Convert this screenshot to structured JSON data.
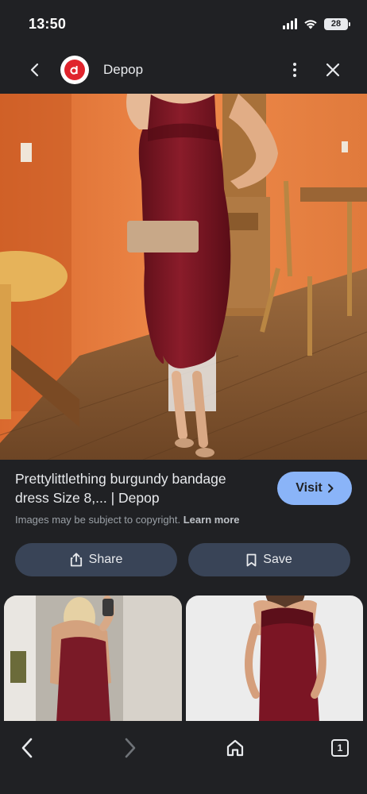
{
  "status": {
    "time": "13:50",
    "battery": "28"
  },
  "header": {
    "site_name": "Depop",
    "logo_letter": "d"
  },
  "result": {
    "title": "Prettylittlething burgundy bandage dress Size 8,... | Depop",
    "visit_label": "Visit",
    "copyright_text": "Images may be subject to copyright.",
    "learn_more": "Learn more"
  },
  "actions": {
    "share_label": "Share",
    "save_label": "Save"
  },
  "tabs": {
    "count": "1"
  },
  "colors": {
    "background": "#202124",
    "accent": "#8ab4f8",
    "button": "#394457",
    "brand_red": "#e0242d",
    "dress": "#7a1522"
  },
  "icons": [
    "back-icon",
    "more-vert-icon",
    "close-icon",
    "share-icon",
    "bookmark-icon",
    "home-icon",
    "forward-icon",
    "wifi-icon",
    "signal-icon"
  ]
}
